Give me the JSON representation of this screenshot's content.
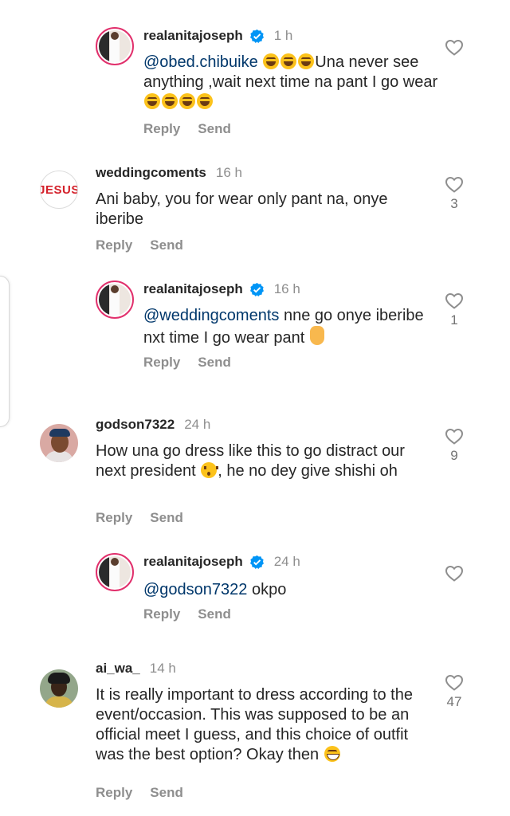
{
  "labels": {
    "reply": "Reply",
    "send": "Send"
  },
  "comments": [
    {
      "username": "realanitajoseph",
      "time": "1 h",
      "mention": "@obed.chibuike",
      "text_after_emoji": "Una never see anything ,wait next time na pant I go wear",
      "likes": ""
    },
    {
      "username": "weddingcoments",
      "time": "16 h",
      "avatar_text": "JESUS",
      "text": "Ani baby, you for wear only pant na, onye iberibe",
      "likes": "3"
    },
    {
      "username": "realanitajoseph",
      "time": "16 h",
      "mention": "@weddingcoments",
      "text": " nne go onye iberibe nxt time I go wear pant",
      "likes": "1"
    },
    {
      "username": "godson7322",
      "time": "24 h",
      "text_part1": "How una go dress like this to go distract our next president",
      "text_part2": ", he no dey give shishi oh",
      "likes": "9"
    },
    {
      "username": "realanitajoseph",
      "time": "24 h",
      "mention": "@godson7322",
      "text": " okpo",
      "likes": ""
    },
    {
      "username": "ai_wa_",
      "time": "14 h",
      "text": "It is really important to dress according to the event/occasion.  This was supposed to be an official meet I guess, and this choice of outfit was the best option? Okay then",
      "likes": "47"
    }
  ],
  "icons": {
    "like": "heart-outline-icon",
    "verified": "verified-badge-icon"
  },
  "colors": {
    "mention": "#00376b",
    "verified": "#0095f6",
    "muted": "#8e8e8e"
  }
}
